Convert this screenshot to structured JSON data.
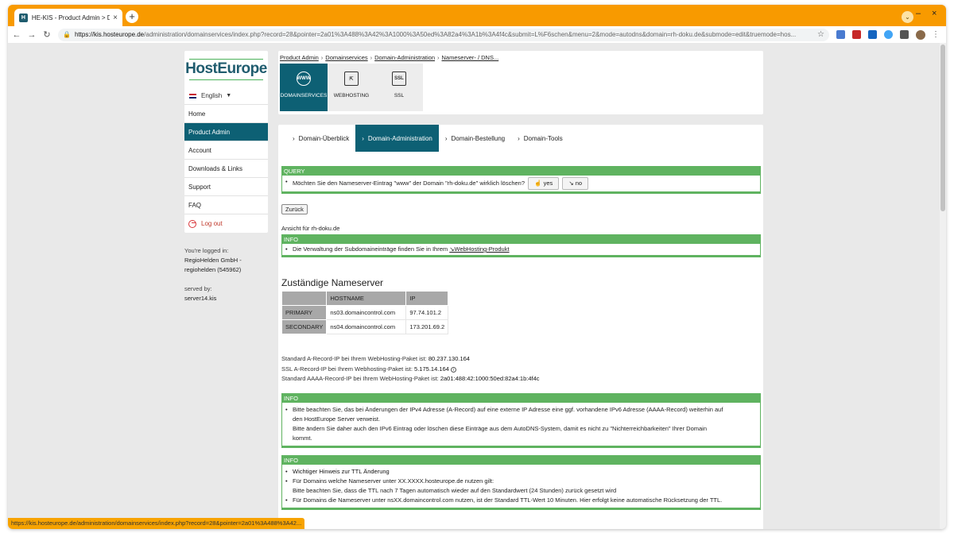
{
  "browser": {
    "tab_title": "HE-KIS - Product Admin > Dom",
    "url_host": "https://kis.hosteurope.de",
    "url_rest": "/administration/domainservices/index.php?record=28&pointer=2a01%3A488%3A42%3A1000%3A50ed%3A82a4%3A1b%3A4f4c&submit=L%F6schen&menu=2&mode=autodns&domain=rh-doku.de&submode=edit&truemode=hos...",
    "status_url": "https://kis.hosteurope.de/administration/domainservices/index.php?record=28&pointer=2a01%3A488%3A42..."
  },
  "sidebar": {
    "logo": "HostEurope",
    "language": "English",
    "items": [
      {
        "label": "Home"
      },
      {
        "label": "Product Admin"
      },
      {
        "label": "Account"
      },
      {
        "label": "Downloads & Links"
      },
      {
        "label": "Support"
      },
      {
        "label": "FAQ"
      }
    ],
    "logout": "Log out",
    "logged_in_label": "You're logged in:",
    "company": "RegioHelden GmbH -",
    "user": "regiohelden (545962)",
    "served_by_label": "served by:",
    "server": "server14.kis"
  },
  "breadcrumb": [
    "Product Admin",
    "Domainservices",
    "Domain-Administration",
    "Nameserver- / DNS..."
  ],
  "products": [
    {
      "label": "DOMAINSERVICES",
      "icon": "WWW"
    },
    {
      "label": "WEBHOSTING",
      "icon": "⇱"
    },
    {
      "label": "SSL",
      "icon": "SSL"
    }
  ],
  "subtabs": [
    "Domain-Überblick",
    "Domain-Administration",
    "Domain-Bestellung",
    "Domain-Tools"
  ],
  "query": {
    "head": "QUERY",
    "text": "Möchten Sie den Nameserver-Eintrag \"www\" der Domain \"rh-doku.de\" wirklich löschen?",
    "yes": "yes",
    "no": "no"
  },
  "back_button": "Zurück",
  "view_for": "Ansicht für rh-doku.de",
  "info1": {
    "head": "INFO",
    "text": "Die Verwaltung der Subdomaineinträge finden Sie in Ihrem",
    "link": "↘WebHosting-Produkt"
  },
  "nameservers": {
    "title": "Zuständige Nameserver",
    "headers": [
      "HOSTNAME",
      "IP"
    ],
    "rows": [
      {
        "label": "PRIMARY",
        "host": "ns03.domaincontrol.com",
        "ip": "97.74.101.2"
      },
      {
        "label": "SECONDARY",
        "host": "ns04.domaincontrol.com",
        "ip": "173.201.69.2"
      }
    ]
  },
  "ip_info": {
    "a_label": "Standard A-Record-IP bei Ihrem WebHosting-Paket ist:",
    "a_value": "80.237.130.164",
    "ssl_label": "SSL A-Record-IP bei Ihrem Webhosting-Paket ist:",
    "ssl_value": "5.175.14.164",
    "aaaa_label": "Standard AAAA-Record-IP bei Ihrem WebHosting-Paket ist:",
    "aaaa_value": "2a01:488:42:1000:50ed:82a4:1b:4f4c"
  },
  "info2": {
    "head": "INFO",
    "line1": "Bitte beachten Sie, das bei Änderungen der IPv4 Adresse (A-Record) auf eine externe IP Adresse eine ggf. vorhandene IPv6 Adresse (AAAA-Record) weiterhin auf",
    "line2": "den HostEurope Server verweist.",
    "line3": "Bitte ändern Sie daher auch den IPv6 Eintrag oder löschen diese Einträge aus dem AutoDNS-System, damit es nicht zu \"Nichterreichbarkeiten\" Ihrer Domain",
    "line4": "kommt."
  },
  "info3": {
    "head": "INFO",
    "title": "Wichtiger Hinweis zur TTL Änderung",
    "line1": "Für Domains welche Nameserver unter XX.XXXX.hosteurope.de nutzen gilt:",
    "line2": "Bitte beachten Sie, dass die TTL nach 7 Tagen automatisch wieder auf den Standardwert (24 Stunden) zurück gesetzt wird",
    "line3": "Für Domains die Nameserver unter nsXX.domaincontrol.com nutzen, ist der Standard TTL-Wert 10 Minuten. Hier erfolgt keine automatische Rücksetzung der TTL."
  }
}
